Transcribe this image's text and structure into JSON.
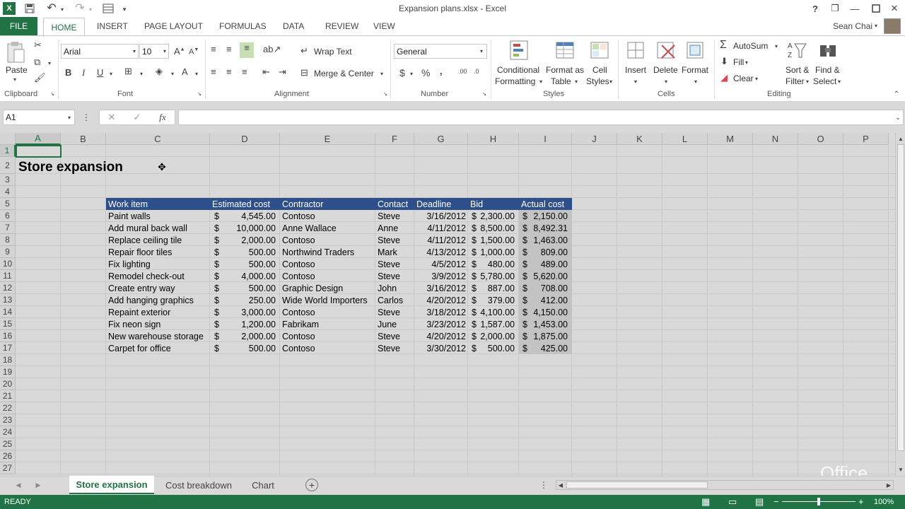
{
  "window": {
    "title": "Expansion plans.xlsx - Excel",
    "help": "?",
    "minimize": "—",
    "restore": "❐",
    "close": "✕"
  },
  "qat": {
    "app_icon": "X",
    "save": "save-icon",
    "undo": "undo-icon",
    "redo": "redo-icon"
  },
  "ribbon_tabs": {
    "file": "FILE",
    "home": "HOME",
    "insert": "INSERT",
    "page_layout": "PAGE LAYOUT",
    "formulas": "FORMULAS",
    "data": "DATA",
    "review": "REVIEW",
    "view": "VIEW"
  },
  "user": {
    "name": "Sean Chai"
  },
  "clipboard": {
    "paste": "Paste",
    "label": "Clipboard"
  },
  "font": {
    "name": "Arial",
    "size": "10",
    "bold": "B",
    "italic": "I",
    "underline": "U",
    "label": "Font",
    "grow": "A",
    "shrink": "A"
  },
  "alignment": {
    "wrap": "Wrap Text",
    "merge": "Merge & Center",
    "label": "Alignment"
  },
  "number": {
    "format": "General",
    "currency": "$",
    "percent": "%",
    "comma": ",",
    "inc": ".00",
    "dec": ".0",
    "label": "Number"
  },
  "styles": {
    "conditional": "Conditional",
    "formatting": "Formatting",
    "format_as": "Format as",
    "table": "Table",
    "cell": "Cell",
    "cell_styles": "Styles",
    "label": "Styles"
  },
  "cells": {
    "insert": "Insert",
    "delete": "Delete",
    "format": "Format",
    "label": "Cells"
  },
  "editing": {
    "autosum": "AutoSum",
    "fill": "Fill",
    "clear": "Clear",
    "sort": "Sort &",
    "filter": "Filter",
    "find": "Find &",
    "select": "Select",
    "label": "Editing"
  },
  "formula_bar": {
    "name_box": "A1",
    "cancel": "✕",
    "enter": "✓",
    "fx": "fx",
    "value": ""
  },
  "columns": [
    "A",
    "B",
    "C",
    "D",
    "E",
    "F",
    "G",
    "H",
    "I",
    "J",
    "K",
    "L",
    "M",
    "N",
    "O",
    "P"
  ],
  "rows": [
    "1",
    "2",
    "3",
    "4",
    "5",
    "6",
    "7",
    "8",
    "9",
    "10",
    "11",
    "12",
    "13",
    "14",
    "15",
    "16",
    "17",
    "18",
    "19",
    "20",
    "21",
    "22",
    "23",
    "24",
    "25",
    "26",
    "27"
  ],
  "sheet_title": "Store expansion",
  "table": {
    "headers": [
      "Work item",
      "Estimated cost",
      "Contractor",
      "Contact",
      "Deadline",
      "Bid",
      "Actual cost"
    ],
    "rows": [
      [
        "Paint walls",
        "$",
        "4,545.00",
        "Contoso",
        "Steve",
        "3/16/2012",
        "$",
        "2,300.00",
        "$",
        "2,150.00"
      ],
      [
        "Add mural back wall",
        "$",
        "10,000.00",
        "Anne Wallace",
        "Anne",
        "4/11/2012",
        "$",
        "8,500.00",
        "$",
        "8,492.31"
      ],
      [
        "Replace ceiling tile",
        "$",
        "2,000.00",
        "Contoso",
        "Steve",
        "4/11/2012",
        "$",
        "1,500.00",
        "$",
        "1,463.00"
      ],
      [
        "Repair floor tiles",
        "$",
        "500.00",
        "Northwind Traders",
        "Mark",
        "4/13/2012",
        "$",
        "1,000.00",
        "$",
        "809.00"
      ],
      [
        "Fix lighting",
        "$",
        "500.00",
        "Contoso",
        "Steve",
        "4/5/2012",
        "$",
        "480.00",
        "$",
        "489.00"
      ],
      [
        "Remodel check-out",
        "$",
        "4,000.00",
        "Contoso",
        "Steve",
        "3/9/2012",
        "$",
        "5,780.00",
        "$",
        "5,620.00"
      ],
      [
        "Create entry way",
        "$",
        "500.00",
        "Graphic Design",
        "John",
        "3/16/2012",
        "$",
        "887.00",
        "$",
        "708.00"
      ],
      [
        "Add hanging graphics",
        "$",
        "250.00",
        "Wide World Importers",
        "Carlos",
        "4/20/2012",
        "$",
        "379.00",
        "$",
        "412.00"
      ],
      [
        "Repaint exterior",
        "$",
        "3,000.00",
        "Contoso",
        "Steve",
        "3/18/2012",
        "$",
        "4,100.00",
        "$",
        "4,150.00"
      ],
      [
        "Fix neon sign",
        "$",
        "1,200.00",
        "Fabrikam",
        "June",
        "3/23/2012",
        "$",
        "1,587.00",
        "$",
        "1,453.00"
      ],
      [
        "New warehouse storage",
        "$",
        "2,000.00",
        "Contoso",
        "Steve",
        "4/20/2012",
        "$",
        "2,000.00",
        "$",
        "1,875.00"
      ],
      [
        "Carpet for office",
        "$",
        "500.00",
        "Contoso",
        "Steve",
        "3/30/2012",
        "$",
        "500.00",
        "$",
        "425.00"
      ]
    ]
  },
  "sheets": [
    "Store expansion",
    "Cost breakdown",
    "Chart"
  ],
  "add_sheet": "+",
  "status": {
    "ready": "READY",
    "zoom": "100%"
  },
  "office_logo": "Office",
  "colors": {
    "accent": "#217346",
    "header": "#44546a",
    "table_header": "#2f4f8a"
  }
}
